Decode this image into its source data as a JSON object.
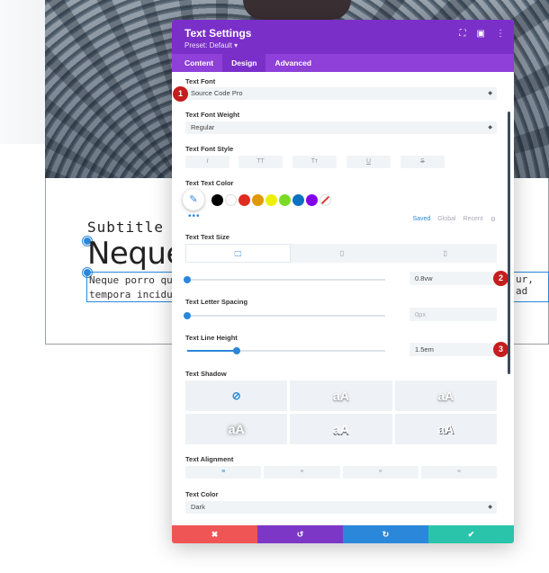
{
  "background": {
    "subtitle": "Subtitle",
    "heading": "Neque",
    "body_line1": "Neque porro qui",
    "body_line2": "tempora incidu",
    "body_right": "ur, ad"
  },
  "modal": {
    "title": "Text Settings",
    "preset": "Preset: Default ▾",
    "header_icons": [
      "expand-icon",
      "sidebar-icon",
      "more-icon"
    ],
    "tabs": [
      {
        "label": "Content",
        "active": false
      },
      {
        "label": "Design",
        "active": true
      },
      {
        "label": "Advanced",
        "active": false
      }
    ],
    "text_font": {
      "label": "Text Font",
      "value": "Source Code Pro"
    },
    "font_weight": {
      "label": "Text Font Weight",
      "value": "Regular"
    },
    "font_style": {
      "label": "Text Font Style",
      "buttons": [
        "I",
        "TT",
        "Tт",
        "U",
        "S"
      ]
    },
    "text_color": {
      "label": "Text Text Color",
      "swatches": [
        "#000000",
        "#ffffff",
        "#e02b20",
        "#e09900",
        "#edf000",
        "#7cda24",
        "#0c71c3",
        "#8300e9"
      ],
      "tabs": [
        "Saved",
        "Global",
        "Recent"
      ],
      "active_tab": "Saved"
    },
    "text_size": {
      "label": "Text Text Size",
      "value": "0.8vw",
      "slider_fraction": 0.0
    },
    "letter_spacing": {
      "label": "Text Letter Spacing",
      "value": "0px",
      "slider_fraction": 0.0
    },
    "line_height": {
      "label": "Text Line Height",
      "value": "1.5em",
      "slider_fraction": 0.25
    },
    "shadow": {
      "label": "Text Shadow",
      "samples": [
        "aA",
        "aA",
        "aA",
        "aA",
        "aA"
      ]
    },
    "alignment": {
      "label": "Text Alignment",
      "options": [
        "≡",
        "≡",
        "≡",
        "≡"
      ]
    },
    "color": {
      "label": "Text Color",
      "value": "Dark"
    },
    "footer": [
      {
        "icon": "close-icon",
        "glyph": "✖",
        "color": "#ef5555"
      },
      {
        "icon": "undo-icon",
        "glyph": "↺",
        "color": "#7c37c7"
      },
      {
        "icon": "redo-icon",
        "glyph": "↻",
        "color": "#2b87da"
      },
      {
        "icon": "save-icon",
        "glyph": "✔",
        "color": "#29c4a9"
      }
    ],
    "callouts": [
      "1",
      "2",
      "3"
    ]
  }
}
